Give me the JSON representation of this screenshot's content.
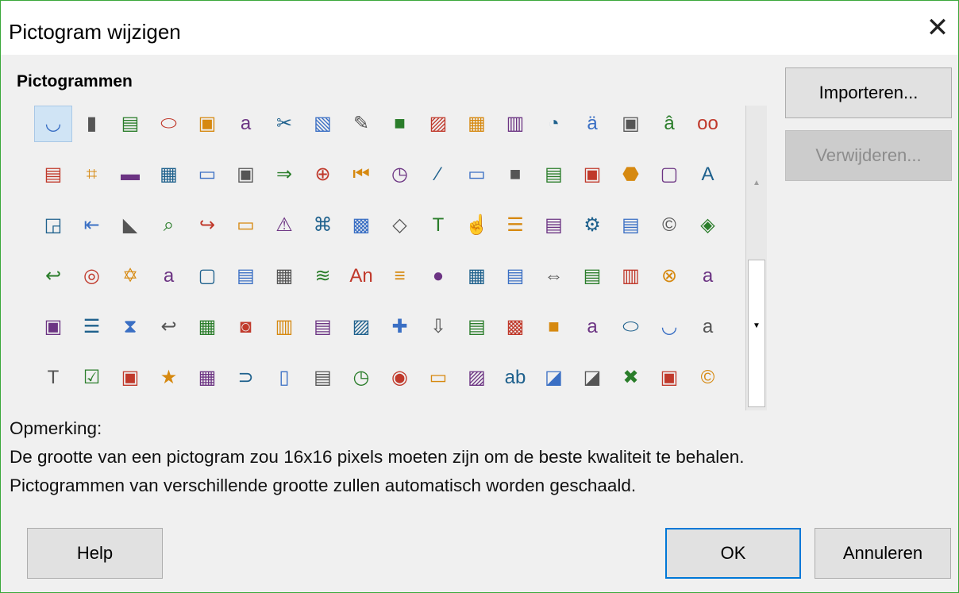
{
  "dialog": {
    "title": "Pictogram wijzigen",
    "close_glyph": "✕"
  },
  "section": {
    "heading": "Pictogrammen"
  },
  "icons": {
    "rows": [
      [
        "◡",
        "▮",
        "▤",
        "⬭",
        "▣",
        "a",
        "✂",
        "▧",
        "✎",
        "■",
        "▨",
        "▦",
        "▥",
        "◔",
        "ä",
        "▣",
        "â",
        "oo",
        "▩"
      ],
      [
        "▤",
        "⌗",
        "▬",
        "▦",
        "▭",
        "▣",
        "⇒",
        "⊕",
        "⏮",
        "◷",
        "∕",
        "▭",
        "■",
        "▤",
        "▣",
        "⬣",
        "▢",
        "A"
      ],
      [
        "◲",
        "⇤",
        "◣",
        "⌕",
        "↪",
        "▭",
        "⚠",
        "⌘",
        "▩",
        "◇",
        "T",
        "☝",
        "☰",
        "▤",
        "⚙",
        "▤",
        "©",
        "◈"
      ],
      [
        "↩",
        "◎",
        "✡",
        "a",
        "▢",
        "▤",
        "▦",
        "≋",
        "An",
        "≡",
        "●",
        "▦",
        "▤",
        "⇔",
        "▤",
        "▥",
        "⊗",
        "a"
      ],
      [
        "▣",
        "☰",
        "⧗",
        "↩",
        "▦",
        "◙",
        "▥",
        "▤",
        "▨",
        "✚",
        "⇩",
        "▤",
        "▩",
        "■",
        "a",
        "⬭",
        "◡",
        "a"
      ],
      [
        "T",
        "☑",
        "▣",
        "★",
        "▦",
        "⊃",
        "▯",
        "▤",
        "◷",
        "◉",
        "▭",
        "▨",
        "ab",
        "◪",
        "◪",
        "✖",
        "▣",
        "©",
        "⇨"
      ]
    ]
  },
  "buttons": {
    "import": "Importeren...",
    "remove": "Verwijderen...",
    "help": "Help",
    "ok": "OK",
    "cancel": "Annuleren"
  },
  "note": {
    "label": "Opmerking:",
    "line1": "De grootte van een pictogram zou 16x16 pixels moeten zijn om de beste kwaliteit te behalen.",
    "line2": "Pictogrammen van verschillende grootte zullen automatisch worden geschaald."
  },
  "colors": {
    "accent": "#0078d7",
    "selection": "#d0e4f5",
    "window_border": "#3aa83a"
  }
}
